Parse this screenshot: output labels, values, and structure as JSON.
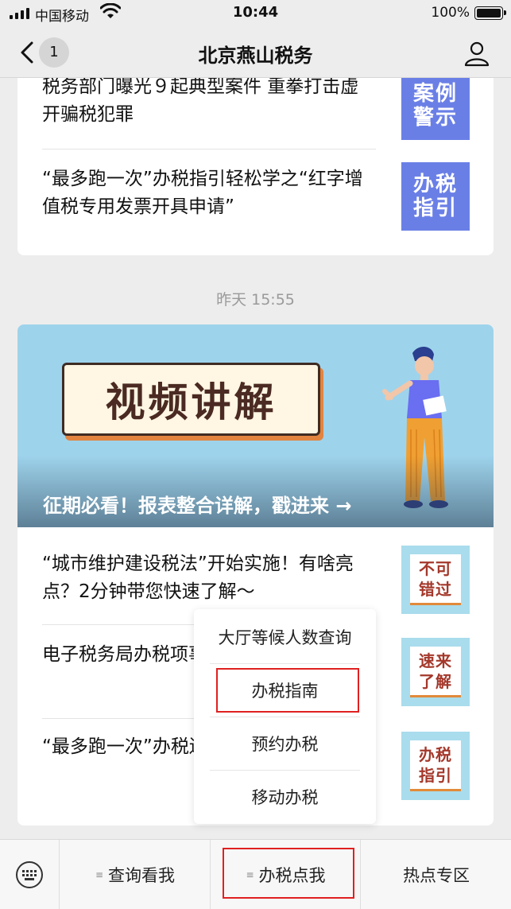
{
  "status_bar": {
    "carrier": "中国移动",
    "time": "10:44",
    "battery": "100%"
  },
  "nav": {
    "back_count": "1",
    "title": "北京燕山税务"
  },
  "card1": {
    "items": [
      {
        "title": "税务部门曝光９起典型案件 重拳打击虚开骗税犯罪",
        "thumb": "案例警示"
      },
      {
        "title": "“最多跑一次”办税指引轻松学之“红字增值税专用发票开具申请”",
        "thumb": "办税指引"
      }
    ]
  },
  "timestamp": "昨天 15:55",
  "card2": {
    "hero": {
      "banner_text": "视频讲解",
      "caption": "征期必看！报表整合详解，戳进来 →"
    },
    "items": [
      {
        "title": "“城市维护建设税法”开始实施！有啥亮点？2分钟带您快速了解～",
        "thumb": "不可错过"
      },
      {
        "title": "电子税务局办税项事项如何办理？速",
        "thumb": "速来了解"
      },
      {
        "title": "“最多跑一次”办税遗失、损毁报告”",
        "thumb": "办税指引"
      }
    ]
  },
  "popup_menu": {
    "items": [
      "大厅等候人数查询",
      "办税指南",
      "预约办税",
      "移动办税"
    ]
  },
  "bottom_menu": {
    "tabs": [
      "查询看我",
      "办税点我",
      "热点专区"
    ]
  },
  "colors": {
    "highlight": "#e02020",
    "thumb_blue": "#6a7fe6",
    "thumb_light": "#a9dcec"
  }
}
